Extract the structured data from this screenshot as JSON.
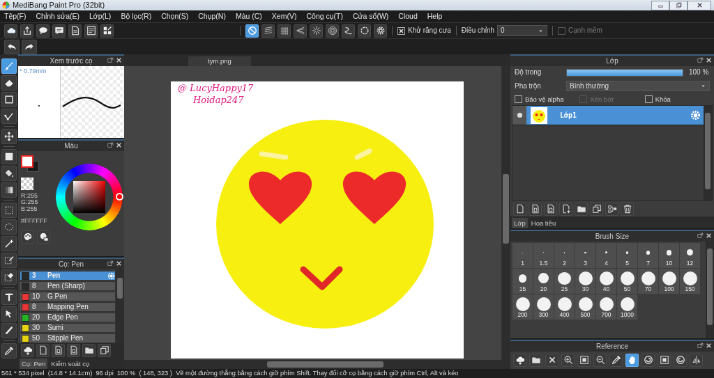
{
  "window": {
    "title": "MediBang Paint Pro (32bit)"
  },
  "menu": [
    "Tệp(F)",
    "Chỉnh sửa(E)",
    "Lớp(L)",
    "Bộ lọc(R)",
    "Chọn(S)",
    "Chụp(N)",
    "Màu (C)",
    "Xem(V)",
    "Công cụ(T)",
    "Cửa sổ(W)",
    "Cloud",
    "Help"
  ],
  "toolbar": {
    "snap_modes": [
      {
        "selected": true
      },
      {
        "selected": false
      },
      {
        "selected": false
      },
      {
        "selected": false
      },
      {
        "selected": false
      },
      {
        "selected": false
      },
      {
        "selected": false
      },
      {
        "selected": false
      },
      {
        "selected": false
      }
    ],
    "antialias": {
      "label": "Khử răng cưa",
      "checked": true
    },
    "correction": {
      "label": "Điều chỉnh",
      "value": "0"
    },
    "soft_edge": {
      "label": "Cạnh mềm",
      "checked": false,
      "disabled": true
    }
  },
  "tools": [
    {
      "selected": true
    },
    {
      "selected": false
    },
    {
      "selected": false
    },
    {
      "selected": false
    },
    {
      "selected": false
    },
    {
      "selected": false
    },
    {
      "selected": false
    },
    {
      "selected": false
    },
    {
      "selected": false
    },
    {
      "selected": false
    },
    {
      "selected": false
    },
    {
      "selected": false
    },
    {
      "selected": false
    },
    {
      "selected": false
    },
    {
      "selected": false
    },
    {
      "selected": false
    },
    {
      "selected": false
    }
  ],
  "brush_preview": {
    "title": "Xem trước cọ",
    "size": "* 0.79mm"
  },
  "color": {
    "title": "Màu",
    "r": "R:255",
    "g": "G:255",
    "b": "B:255",
    "hex": "#FFFFFF"
  },
  "brushes": {
    "title": "Cọ: Pen",
    "items": [
      {
        "color": "#2a2a2a",
        "size": "3",
        "name": "Pen",
        "selected": true
      },
      {
        "color": "#2a2a2a",
        "size": "8",
        "name": "Pen (Sharp)",
        "selected": false
      },
      {
        "color": "#e83535",
        "size": "10",
        "name": "G Pen",
        "selected": false
      },
      {
        "color": "#e83535",
        "size": "8",
        "name": "Mapping Pen",
        "selected": false
      },
      {
        "color": "#22b422",
        "size": "20",
        "name": "Edge Pen",
        "selected": false
      },
      {
        "color": "#e6d412",
        "size": "30",
        "name": "Sumi",
        "selected": false
      },
      {
        "color": "#e6d412",
        "size": "50",
        "name": "Stipple Pen",
        "selected": false
      }
    ],
    "tabs": [
      {
        "label": "Cọ: Pen",
        "selected": true
      },
      {
        "label": "Kiểm soát cọ",
        "selected": false
      }
    ]
  },
  "canvas": {
    "tab": "tym.png",
    "signature": [
      "@ LucyHappy17",
      "Hoidap247"
    ]
  },
  "layers": {
    "title": "Lớp",
    "opacity": {
      "label": "Độ trong",
      "level": 1,
      "reading": "100 %"
    },
    "blend": {
      "label": "Pha trộn",
      "value": "Bình thường"
    },
    "options": [
      {
        "label": "Bảo vệ alpha",
        "checked": false,
        "disabled": false
      },
      {
        "label": "Xén bớt",
        "checked": false,
        "disabled": true
      },
      {
        "label": "Khóa",
        "checked": false,
        "disabled": false
      }
    ],
    "items": [
      {
        "name": "Lớp1",
        "selected": true,
        "visible": true
      }
    ],
    "tabs": [
      {
        "label": "Lớp",
        "selected": true
      },
      {
        "label": "Hoa tiêu",
        "selected": false
      }
    ]
  },
  "brush_size": {
    "title": "Brush Size",
    "sizes": [
      "1",
      "1.5",
      "2",
      "3",
      "4",
      "5",
      "7",
      "10",
      "12",
      "15",
      "20",
      "25",
      "30",
      "40",
      "50",
      "70",
      "100",
      "150",
      "200",
      "300",
      "400",
      "500",
      "700",
      "1000"
    ]
  },
  "reference": {
    "title": "Reference",
    "tools": [
      {
        "selected": false
      },
      {
        "selected": false
      },
      {
        "selected": false
      },
      {
        "selected": false
      },
      {
        "selected": false
      },
      {
        "selected": false
      },
      {
        "selected": false
      },
      {
        "selected": true
      },
      {
        "selected": false
      },
      {
        "selected": false
      },
      {
        "selected": false
      },
      {
        "selected": false
      }
    ]
  },
  "status_bar": "561 * 534 pixel  (14.8 * 14.1cm)  96 dpi  100 %  ( 148, 323 )  Vẽ một đường thẳng bằng cách giữ phím Shift. Thay đổi cỡ cọ bằng cách giữ phím Ctrl, Alt và kéo"
}
